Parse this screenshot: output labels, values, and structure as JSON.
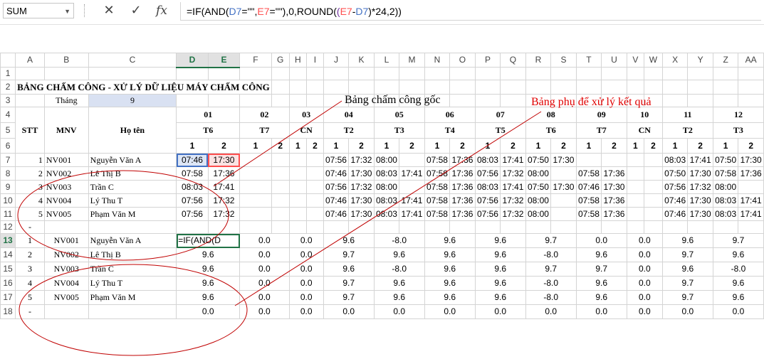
{
  "formula_bar": {
    "name_box": "SUM",
    "cancel_icon": "✕",
    "enter_icon": "✓",
    "fx_label": "fx",
    "formula_parts": [
      "=IF(AND(",
      "D7",
      "=\"\",",
      "E7",
      "=\"\"),0,ROUND(",
      "(",
      "E7",
      "-",
      "D7",
      ")*24,2))"
    ]
  },
  "columns": [
    "A",
    "B",
    "C",
    "D",
    "E",
    "F",
    "G",
    "H",
    "I",
    "J",
    "K",
    "L",
    "M",
    "N",
    "O",
    "P",
    "Q",
    "R",
    "S",
    "T",
    "U",
    "V",
    "W",
    "X",
    "Y",
    "Z",
    "AA"
  ],
  "rows": [
    "1",
    "2",
    "3",
    "4",
    "5",
    "6",
    "7",
    "8",
    "9",
    "10",
    "11",
    "12",
    "13",
    "14",
    "15",
    "16",
    "17",
    "18"
  ],
  "title": "BẢNG CHẤM CÔNG - XỬ LÝ DỮ LIỆU MÁY CHẤM CÔNG",
  "month_label": "Tháng",
  "month_value": "9",
  "headers": {
    "stt": "STT",
    "mnv": "MNV",
    "name": "Họ tên"
  },
  "days": [
    {
      "d": "01",
      "w": "T6"
    },
    {
      "d": "02",
      "w": "T7"
    },
    {
      "d": "03",
      "w": "CN"
    },
    {
      "d": "04",
      "w": "T2"
    },
    {
      "d": "05",
      "w": "T3"
    },
    {
      "d": "06",
      "w": "T4"
    },
    {
      "d": "07",
      "w": "T5"
    },
    {
      "d": "08",
      "w": "T6"
    },
    {
      "d": "09",
      "w": "T7"
    },
    {
      "d": "10",
      "w": "CN"
    },
    {
      "d": "11",
      "w": "T2"
    },
    {
      "d": "12",
      "w": "T3"
    }
  ],
  "sub_labels": [
    "1",
    "2"
  ],
  "raw_rows": [
    {
      "stt": "1",
      "mnv": "NV001",
      "name": "Nguyễn Văn A",
      "t": [
        "07:46",
        "17:30",
        "",
        "",
        "",
        "",
        "07:56",
        "17:32",
        "08:00",
        "",
        "07:58",
        "17:36",
        "08:03",
        "17:41",
        "07:50",
        "17:30",
        "",
        "",
        "",
        "",
        "08:03",
        "17:41",
        "07:50",
        "17:30"
      ]
    },
    {
      "stt": "2",
      "mnv": "NV002",
      "name": "Lê Thị B",
      "t": [
        "07:58",
        "17:36",
        "",
        "",
        "",
        "",
        "07:46",
        "17:30",
        "08:03",
        "17:41",
        "07:58",
        "17:36",
        "07:56",
        "17:32",
        "08:00",
        "",
        "07:58",
        "17:36",
        "",
        "",
        "07:50",
        "17:30",
        "07:58",
        "17:36"
      ]
    },
    {
      "stt": "3",
      "mnv": "NV003",
      "name": "Trần C",
      "t": [
        "08:03",
        "17:41",
        "",
        "",
        "",
        "",
        "07:56",
        "17:32",
        "08:00",
        "",
        "07:58",
        "17:36",
        "08:03",
        "17:41",
        "07:50",
        "17:30",
        "07:46",
        "17:30",
        "",
        "",
        "07:56",
        "17:32",
        "08:00",
        ""
      ]
    },
    {
      "stt": "4",
      "mnv": "NV004",
      "name": "Lý Thu T",
      "t": [
        "07:56",
        "17:32",
        "",
        "",
        "",
        "",
        "07:46",
        "17:30",
        "08:03",
        "17:41",
        "07:58",
        "17:36",
        "07:56",
        "17:32",
        "08:00",
        "",
        "07:58",
        "17:36",
        "",
        "",
        "07:46",
        "17:30",
        "08:03",
        "17:41"
      ]
    },
    {
      "stt": "5",
      "mnv": "NV005",
      "name": "Phạm Văn M",
      "t": [
        "07:56",
        "17:32",
        "",
        "",
        "",
        "",
        "07:46",
        "17:30",
        "08:03",
        "17:41",
        "07:58",
        "17:36",
        "07:56",
        "17:32",
        "08:00",
        "",
        "07:58",
        "17:36",
        "",
        "",
        "07:46",
        "17:30",
        "08:03",
        "17:41"
      ]
    }
  ],
  "row12_stt": "-",
  "active_cell_text": "=IF(AND(D",
  "result_rows": [
    {
      "stt": "1",
      "mnv": "NV001",
      "name": "Nguyễn Văn A",
      "v": [
        "",
        "0.0",
        "0.0",
        "9.6",
        "-8.0",
        "9.6",
        "9.6",
        "9.7",
        "0.0",
        "0.0",
        "9.6",
        "9.7"
      ]
    },
    {
      "stt": "2",
      "mnv": "NV002",
      "name": "Lê Thị B",
      "v": [
        "9.6",
        "0.0",
        "0.0",
        "9.7",
        "9.6",
        "9.6",
        "9.6",
        "-8.0",
        "9.6",
        "0.0",
        "9.7",
        "9.6"
      ]
    },
    {
      "stt": "3",
      "mnv": "NV003",
      "name": "Trần C",
      "v": [
        "9.6",
        "0.0",
        "0.0",
        "9.6",
        "-8.0",
        "9.6",
        "9.6",
        "9.7",
        "9.7",
        "0.0",
        "9.6",
        "-8.0"
      ]
    },
    {
      "stt": "4",
      "mnv": "NV004",
      "name": "Lý Thu T",
      "v": [
        "9.6",
        "0.0",
        "0.0",
        "9.7",
        "9.6",
        "9.6",
        "9.6",
        "-8.0",
        "9.6",
        "0.0",
        "9.7",
        "9.6"
      ]
    },
    {
      "stt": "5",
      "mnv": "NV005",
      "name": "Phạm Văn M",
      "v": [
        "9.6",
        "0.0",
        "0.0",
        "9.7",
        "9.6",
        "9.6",
        "9.6",
        "-8.0",
        "9.6",
        "0.0",
        "9.7",
        "9.6"
      ]
    },
    {
      "stt": "-",
      "mnv": "",
      "name": "",
      "v": [
        "0.0",
        "0.0",
        "0.0",
        "0.0",
        "0.0",
        "0.0",
        "0.0",
        "0.0",
        "0.0",
        "0.0",
        "0.0",
        "0.0"
      ]
    }
  ],
  "annotations": {
    "original_sheet": "Bảng chấm công gốc",
    "helper_sheet": "Bảng phụ để xử lý kết quả"
  },
  "colors": {
    "excel_green": "#217346",
    "ref_blue": "#4472c4",
    "ref_red": "#ff4f4f",
    "month_fill": "#d9e1f2",
    "annotation_red": "#e00000"
  }
}
